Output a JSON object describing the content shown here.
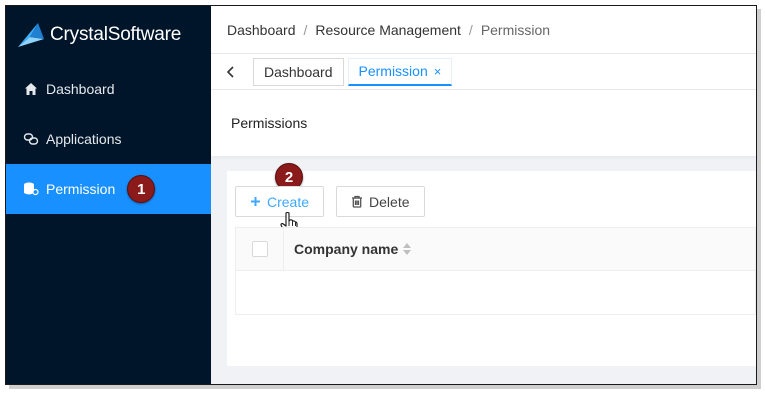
{
  "brand": {
    "name": "CrystalSoftware",
    "accent": "#1890ff",
    "sidebar_bg": "#001529"
  },
  "sidebar": {
    "items": [
      {
        "label": "Dashboard",
        "icon": "home-icon",
        "active": false
      },
      {
        "label": "Applications",
        "icon": "link-icon",
        "active": false
      },
      {
        "label": "Permission",
        "icon": "database-user-icon",
        "active": true,
        "step_badge": "1"
      }
    ]
  },
  "breadcrumb": {
    "items": [
      "Dashboard",
      "Resource Management",
      "Permission"
    ],
    "separator": "/"
  },
  "tabs": {
    "items": [
      {
        "label": "Dashboard",
        "active": false
      },
      {
        "label": "Permission",
        "active": true,
        "close": "×"
      }
    ]
  },
  "page": {
    "title": "Permissions"
  },
  "toolbar": {
    "create_label": "Create",
    "delete_label": "Delete",
    "step_badge": "2"
  },
  "table": {
    "columns": [
      "Company name"
    ],
    "rows": []
  }
}
